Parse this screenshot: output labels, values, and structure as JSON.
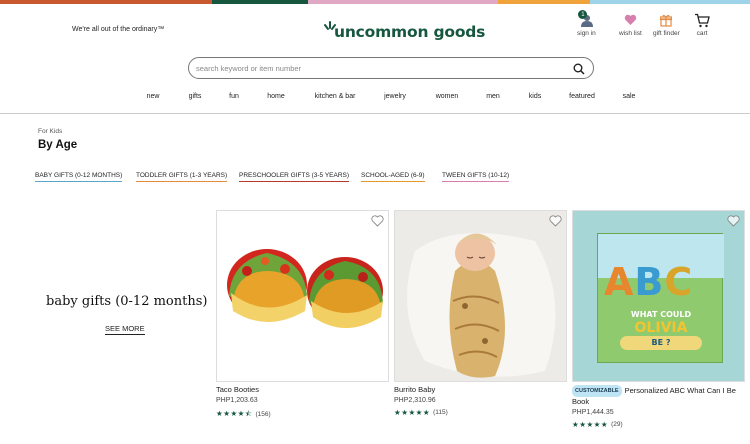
{
  "header": {
    "tagline": "We're all out of the ordinary™",
    "logo_text": "uncommon goods",
    "cart_badge": "1",
    "utilities": [
      {
        "label": "sign in",
        "icon": "user-icon"
      },
      {
        "label": "wish list",
        "icon": "heart-icon"
      },
      {
        "label": "gift finder",
        "icon": "gift-icon"
      },
      {
        "label": "cart",
        "icon": "cart-icon"
      }
    ],
    "strip_colors": [
      "#c7582f",
      "#17573f",
      "#e0a8c4",
      "#f0a23b",
      "#9fd3ea"
    ]
  },
  "search": {
    "placeholder": "search keyword or item number",
    "icon": "search-icon"
  },
  "nav": [
    "new",
    "gifts",
    "fun",
    "home",
    "kitchen & bar",
    "jewelry",
    "women",
    "men",
    "kids",
    "featured",
    "sale"
  ],
  "page": {
    "breadcrumb": "For Kids",
    "title": "By Age"
  },
  "age_tabs": [
    {
      "label": "BABY GIFTS (0-12 MONTHS)",
      "color": "#5aa6c6"
    },
    {
      "label": "TODDLER GIFTS (1-3 YEARS)",
      "color": "#e38a3f"
    },
    {
      "label": "PRESCHOOLER GIFTS (3-5 YEARS)",
      "color": "#b8392c"
    },
    {
      "label": "SCHOOL-AGED (6-9)",
      "color": "#e29a2d"
    },
    {
      "label": "TWEEN GIFTS (10-12)",
      "color": "#d77fae"
    }
  ],
  "feature": {
    "title": "baby gifts (0-12 months)",
    "link": "SEE MORE"
  },
  "products": [
    {
      "name": "Taco Booties",
      "price": "PHP1,203.63",
      "stars": 4.5,
      "stars_text": "★★★★⯪",
      "reviews": "(156)",
      "chip": ""
    },
    {
      "name": "Burrito Baby",
      "price": "PHP2,310.96",
      "stars": 5,
      "stars_text": "★★★★★",
      "reviews": "(115)",
      "chip": ""
    },
    {
      "name": "Personalized ABC What Can I Be Book",
      "price": "PHP1,444.35",
      "stars": 5,
      "stars_text": "★★★★★",
      "reviews": "(29)",
      "chip": "CUSTOMIZABLE",
      "book_title_line1": "WHAT COULD",
      "book_name": "OLIVIA",
      "book_title_line2": "BE ?",
      "book_letters": "ABC"
    }
  ],
  "colors": {
    "brand_green": "#17573f",
    "heart_pink": "#d77fae"
  }
}
